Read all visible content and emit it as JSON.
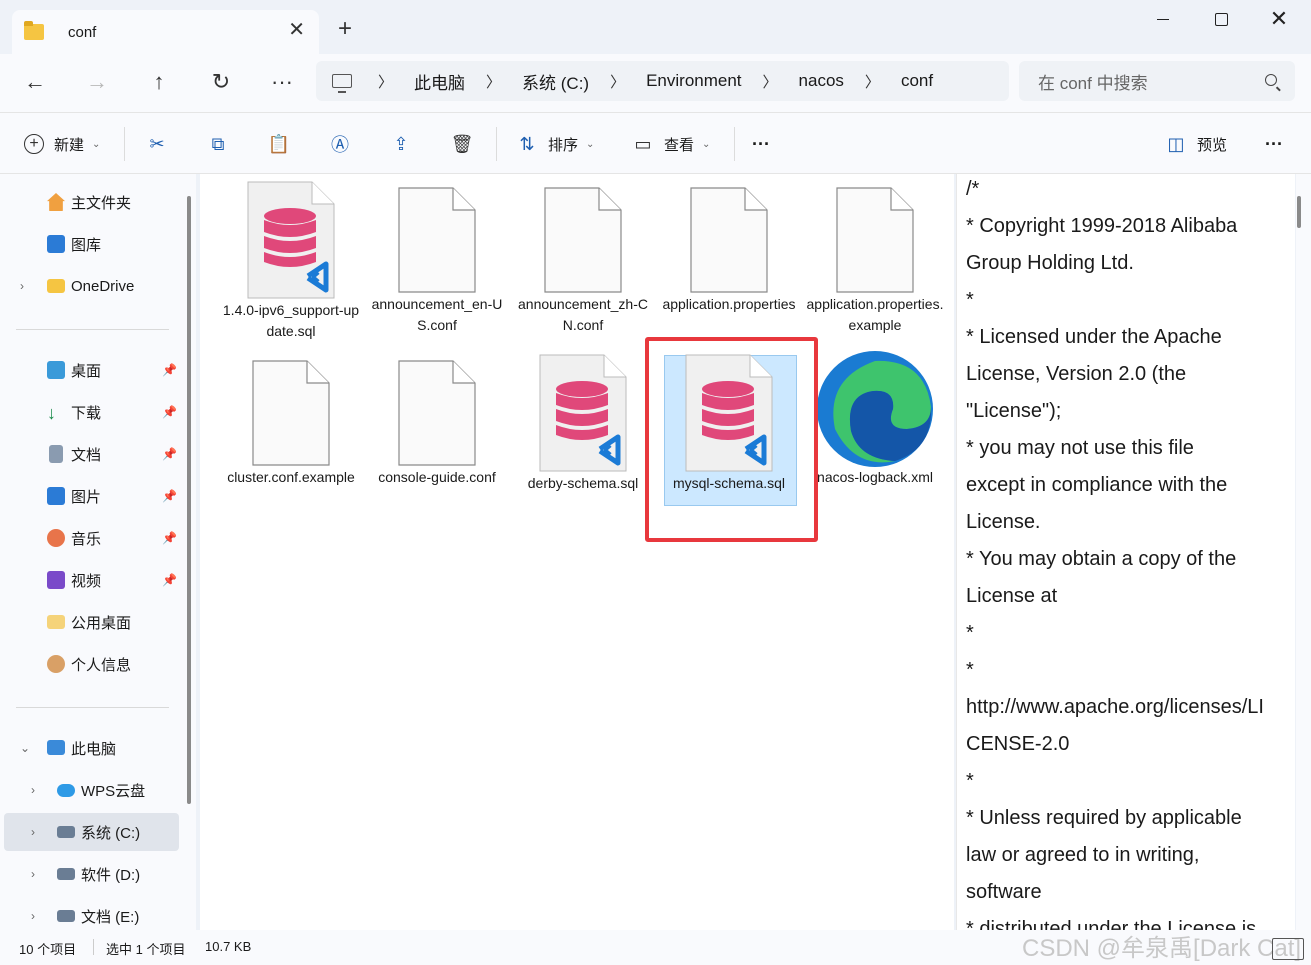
{
  "window": {
    "tab_title": "conf",
    "new_tab": "+",
    "close_tab": "✕"
  },
  "address": {
    "crumbs": [
      "此电脑",
      "系统 (C:)",
      "Environment",
      "nacos",
      "conf"
    ],
    "search_placeholder": "在 conf 中搜索"
  },
  "toolbar": {
    "new_label": "新建",
    "sort_label": "排序",
    "view_label": "查看",
    "preview_label": "预览",
    "more": "···"
  },
  "sidebar": {
    "items": [
      {
        "label": "主文件夹"
      },
      {
        "label": "图库"
      },
      {
        "label": "OneDrive"
      },
      {
        "label": "桌面"
      },
      {
        "label": "下载"
      },
      {
        "label": "文档"
      },
      {
        "label": "图片"
      },
      {
        "label": "音乐"
      },
      {
        "label": "视频"
      },
      {
        "label": "公用桌面"
      },
      {
        "label": "个人信息"
      },
      {
        "label": "此电脑"
      },
      {
        "label": "WPS云盘"
      },
      {
        "label": "系统 (C:)"
      },
      {
        "label": "软件 (D:)"
      },
      {
        "label": "文档 (E:)"
      }
    ]
  },
  "files": [
    {
      "name": "1.4.0-ipv6_support-update.sql",
      "type": "sql"
    },
    {
      "name": "announcement_en-US.conf",
      "type": "doc"
    },
    {
      "name": "announcement_zh-CN.conf",
      "type": "doc"
    },
    {
      "name": "application.properties",
      "type": "doc"
    },
    {
      "name": "application.properties.example",
      "type": "doc"
    },
    {
      "name": "cluster.conf.example",
      "type": "doc"
    },
    {
      "name": "console-guide.conf",
      "type": "doc"
    },
    {
      "name": "derby-schema.sql",
      "type": "sql"
    },
    {
      "name": "mysql-schema.sql",
      "type": "sql",
      "selected": true
    },
    {
      "name": "nacos-logback.xml",
      "type": "edge"
    }
  ],
  "preview": {
    "lines": [
      "/*",
      " * Copyright 1999-2018 Alibaba",
      "Group Holding Ltd.",
      " *",
      " * Licensed under the Apache",
      "License, Version 2.0 (the",
      "\"License\");",
      " * you may not use this file",
      "except in compliance with the",
      "License.",
      " * You may obtain a copy of the",
      "License at",
      " *",
      " *",
      "http://www.apache.org/licenses/LI",
      "CENSE-2.0",
      " *",
      " * Unless required by applicable",
      "law or agreed to in writing,",
      "software",
      " * distributed under the License is"
    ]
  },
  "status": {
    "count": "10 个项目",
    "selected": "选中 1 个项目",
    "size": "10.7 KB"
  },
  "watermark": "CSDN @牟泉禹[Dark Cat]",
  "colors": {
    "accent": "#1f5fb0",
    "selection": "#cce8ff",
    "highlight_box": "#e8383d",
    "sql_db": "#e0487a"
  }
}
